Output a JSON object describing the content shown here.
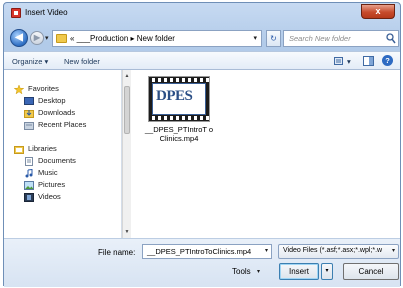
{
  "window": {
    "title": "Insert Video",
    "close_glyph": "x"
  },
  "nav": {
    "back_glyph": "◀",
    "forward_glyph": "▶",
    "history_dropdown_glyph": "▾",
    "address_text": "« ___Production ▸ New folder",
    "address_dropdown_glyph": "▾",
    "refresh_glyph": "↻",
    "search_placeholder": "Search New folder"
  },
  "toolbar": {
    "organize_label": "Organize ▾",
    "new_folder_label": "New folder",
    "view_glyph": "▾",
    "help_glyph": "?"
  },
  "nav_pane": {
    "scroll_up_glyph": "▲",
    "scroll_down_glyph": "▼",
    "items": [
      {
        "label": "Favorites",
        "icon": "star-icon"
      },
      {
        "label": "Desktop",
        "icon": "desktop-icon"
      },
      {
        "label": "Downloads",
        "icon": "downloads-icon"
      },
      {
        "label": "Recent Places",
        "icon": "recent-places-icon"
      },
      {
        "label": "Libraries",
        "icon": "libraries-icon"
      },
      {
        "label": "Documents",
        "icon": "documents-icon"
      },
      {
        "label": "Music",
        "icon": "music-icon"
      },
      {
        "label": "Pictures",
        "icon": "pictures-icon"
      },
      {
        "label": "Videos",
        "icon": "videos-icon"
      }
    ]
  },
  "files": [
    {
      "name": "__DPES_PTIntroToClinics.mp4",
      "name_display": "__DPES_PTIntroT oClinics.mp4",
      "thumb_text": "DPES"
    }
  ],
  "footer": {
    "file_name_label": "File name:",
    "file_name_value": "__DPES_PTIntroToClinics.mp4",
    "file_name_dropdown_glyph": "▾",
    "file_type_value": "Video Files (*.asf;*.asx;*.wpl;*.w",
    "file_type_dropdown_glyph": "▾",
    "tools_label": "Tools",
    "tools_dropdown_glyph": "▾",
    "insert_label": "Insert",
    "insert_dropdown_glyph": "▾",
    "cancel_label": "Cancel"
  },
  "colors": {
    "accent": "#2b4f86",
    "window_frame": "#b2cbe9",
    "close": "#c74b2c"
  }
}
